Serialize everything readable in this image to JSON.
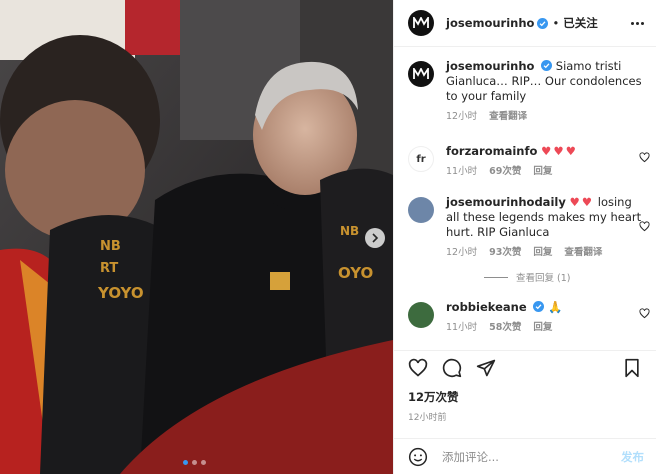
{
  "colors": {
    "accent": "#0095f6",
    "verified": "#3897f0",
    "heart": "#ed4956",
    "muted": "#8e8e8e"
  },
  "post_image": {
    "description_icon": "photo-of-roma-team-bowing-heads",
    "carousel_dots": 3,
    "active_dot": 1
  },
  "header": {
    "avatar_icon": "jose-mourinho-logo-avatar",
    "username": "josemourinho",
    "separator": "•",
    "follow_label": "已关注",
    "more_icon": "more-options-icon"
  },
  "caption": {
    "username": "josemourinho",
    "text": "Siamo tristi Gianluca… RIP… Our condolences to your family",
    "time": "12小时",
    "translate": "查看翻译"
  },
  "comments": [
    {
      "username": "forzaromainfo",
      "avatar_text": "fr",
      "hearts": "♥♥♥",
      "text": "",
      "time": "11小时",
      "likes": "69次赞",
      "reply": "回复"
    },
    {
      "username": "josemourinhodaily",
      "hearts": "♥♥",
      "text": "losing all these legends makes my heart hurt. RIP Gianluca",
      "time": "12小时",
      "likes": "93次赞",
      "reply": "回复",
      "translate": "查看翻译",
      "view_replies": "查看回复 (1)"
    },
    {
      "username": "robbiekeane",
      "emoji": "🙏",
      "text": "",
      "time": "11小时",
      "likes": "58次赞",
      "reply": "回复"
    }
  ],
  "actions": {
    "like_icon": "heart-icon",
    "comment_icon": "comment-icon",
    "share_icon": "share-icon",
    "save_icon": "bookmark-icon"
  },
  "likes_count": "12万次赞",
  "post_time": "12小时前",
  "add_comment": {
    "emoji_icon": "emoji-icon",
    "placeholder": "添加评论...",
    "post_label": "发布"
  }
}
